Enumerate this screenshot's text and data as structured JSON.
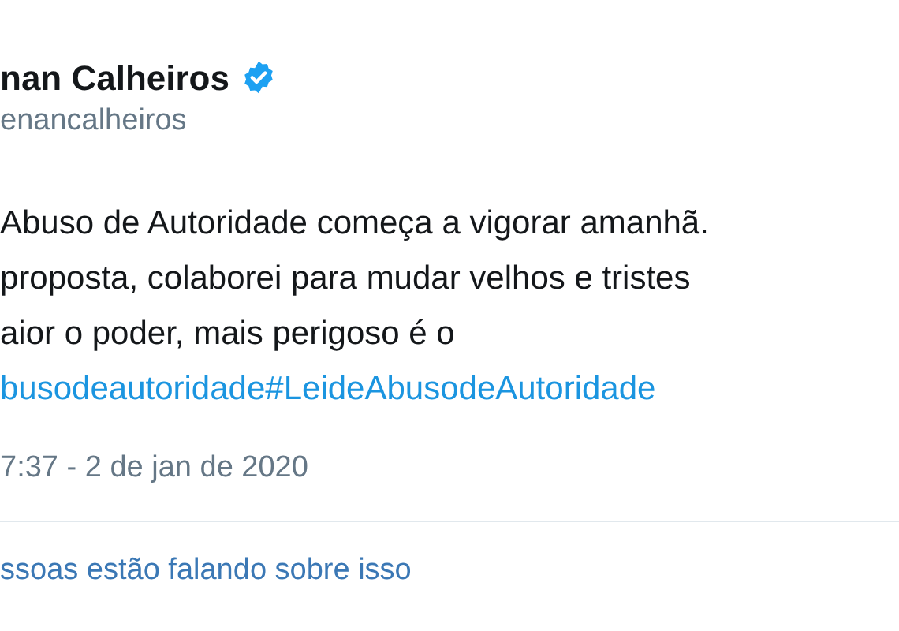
{
  "author": {
    "name": "nan Calheiros",
    "verified": true,
    "handle": "enancalheiros"
  },
  "body_lines": [
    "Abuso de Autoridade começa a vigorar amanhã.",
    "proposta, colaborei para mudar velhos e tristes",
    "aior o poder, mais perigoso é o"
  ],
  "hashtags": [
    "busodeautoridade",
    "#LeideAbusodeAutoridade"
  ],
  "timestamp": "7:37 - 2 de jan de 2020",
  "conversation_link": "ssoas estão falando sobre isso"
}
